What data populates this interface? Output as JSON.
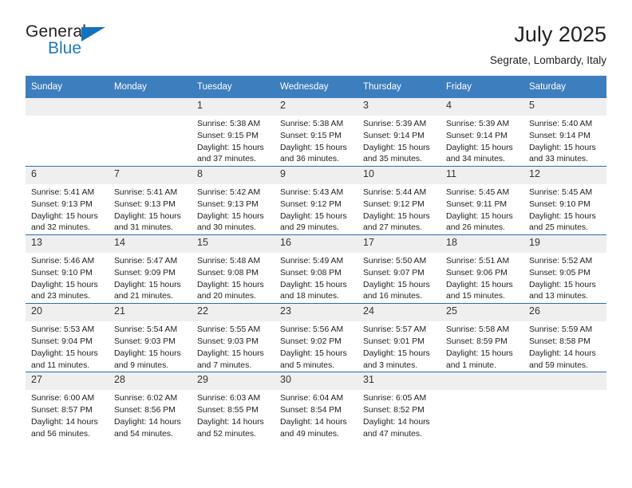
{
  "brand": {
    "name_top": "General",
    "name_bottom": "Blue",
    "triangle_color": "#1273bd",
    "blue_color": "#1c7ac0"
  },
  "header": {
    "title": "July 2025",
    "subtitle": "Segrate, Lombardy, Italy"
  },
  "theme": {
    "header_bg": "#3d7ebe",
    "row_divider": "#2b6cad",
    "daynum_bg": "#efefef"
  },
  "calendar": {
    "weekday_headers": [
      "Sunday",
      "Monday",
      "Tuesday",
      "Wednesday",
      "Thursday",
      "Friday",
      "Saturday"
    ],
    "weeks": [
      [
        {
          "day": "",
          "lines": []
        },
        {
          "day": "",
          "lines": []
        },
        {
          "day": "1",
          "lines": [
            "Sunrise: 5:38 AM",
            "Sunset: 9:15 PM",
            "Daylight: 15 hours",
            "and 37 minutes."
          ]
        },
        {
          "day": "2",
          "lines": [
            "Sunrise: 5:38 AM",
            "Sunset: 9:15 PM",
            "Daylight: 15 hours",
            "and 36 minutes."
          ]
        },
        {
          "day": "3",
          "lines": [
            "Sunrise: 5:39 AM",
            "Sunset: 9:14 PM",
            "Daylight: 15 hours",
            "and 35 minutes."
          ]
        },
        {
          "day": "4",
          "lines": [
            "Sunrise: 5:39 AM",
            "Sunset: 9:14 PM",
            "Daylight: 15 hours",
            "and 34 minutes."
          ]
        },
        {
          "day": "5",
          "lines": [
            "Sunrise: 5:40 AM",
            "Sunset: 9:14 PM",
            "Daylight: 15 hours",
            "and 33 minutes."
          ]
        }
      ],
      [
        {
          "day": "6",
          "lines": [
            "Sunrise: 5:41 AM",
            "Sunset: 9:13 PM",
            "Daylight: 15 hours",
            "and 32 minutes."
          ]
        },
        {
          "day": "7",
          "lines": [
            "Sunrise: 5:41 AM",
            "Sunset: 9:13 PM",
            "Daylight: 15 hours",
            "and 31 minutes."
          ]
        },
        {
          "day": "8",
          "lines": [
            "Sunrise: 5:42 AM",
            "Sunset: 9:13 PM",
            "Daylight: 15 hours",
            "and 30 minutes."
          ]
        },
        {
          "day": "9",
          "lines": [
            "Sunrise: 5:43 AM",
            "Sunset: 9:12 PM",
            "Daylight: 15 hours",
            "and 29 minutes."
          ]
        },
        {
          "day": "10",
          "lines": [
            "Sunrise: 5:44 AM",
            "Sunset: 9:12 PM",
            "Daylight: 15 hours",
            "and 27 minutes."
          ]
        },
        {
          "day": "11",
          "lines": [
            "Sunrise: 5:45 AM",
            "Sunset: 9:11 PM",
            "Daylight: 15 hours",
            "and 26 minutes."
          ]
        },
        {
          "day": "12",
          "lines": [
            "Sunrise: 5:45 AM",
            "Sunset: 9:10 PM",
            "Daylight: 15 hours",
            "and 25 minutes."
          ]
        }
      ],
      [
        {
          "day": "13",
          "lines": [
            "Sunrise: 5:46 AM",
            "Sunset: 9:10 PM",
            "Daylight: 15 hours",
            "and 23 minutes."
          ]
        },
        {
          "day": "14",
          "lines": [
            "Sunrise: 5:47 AM",
            "Sunset: 9:09 PM",
            "Daylight: 15 hours",
            "and 21 minutes."
          ]
        },
        {
          "day": "15",
          "lines": [
            "Sunrise: 5:48 AM",
            "Sunset: 9:08 PM",
            "Daylight: 15 hours",
            "and 20 minutes."
          ]
        },
        {
          "day": "16",
          "lines": [
            "Sunrise: 5:49 AM",
            "Sunset: 9:08 PM",
            "Daylight: 15 hours",
            "and 18 minutes."
          ]
        },
        {
          "day": "17",
          "lines": [
            "Sunrise: 5:50 AM",
            "Sunset: 9:07 PM",
            "Daylight: 15 hours",
            "and 16 minutes."
          ]
        },
        {
          "day": "18",
          "lines": [
            "Sunrise: 5:51 AM",
            "Sunset: 9:06 PM",
            "Daylight: 15 hours",
            "and 15 minutes."
          ]
        },
        {
          "day": "19",
          "lines": [
            "Sunrise: 5:52 AM",
            "Sunset: 9:05 PM",
            "Daylight: 15 hours",
            "and 13 minutes."
          ]
        }
      ],
      [
        {
          "day": "20",
          "lines": [
            "Sunrise: 5:53 AM",
            "Sunset: 9:04 PM",
            "Daylight: 15 hours",
            "and 11 minutes."
          ]
        },
        {
          "day": "21",
          "lines": [
            "Sunrise: 5:54 AM",
            "Sunset: 9:03 PM",
            "Daylight: 15 hours",
            "and 9 minutes."
          ]
        },
        {
          "day": "22",
          "lines": [
            "Sunrise: 5:55 AM",
            "Sunset: 9:03 PM",
            "Daylight: 15 hours",
            "and 7 minutes."
          ]
        },
        {
          "day": "23",
          "lines": [
            "Sunrise: 5:56 AM",
            "Sunset: 9:02 PM",
            "Daylight: 15 hours",
            "and 5 minutes."
          ]
        },
        {
          "day": "24",
          "lines": [
            "Sunrise: 5:57 AM",
            "Sunset: 9:01 PM",
            "Daylight: 15 hours",
            "and 3 minutes."
          ]
        },
        {
          "day": "25",
          "lines": [
            "Sunrise: 5:58 AM",
            "Sunset: 8:59 PM",
            "Daylight: 15 hours",
            "and 1 minute."
          ]
        },
        {
          "day": "26",
          "lines": [
            "Sunrise: 5:59 AM",
            "Sunset: 8:58 PM",
            "Daylight: 14 hours",
            "and 59 minutes."
          ]
        }
      ],
      [
        {
          "day": "27",
          "lines": [
            "Sunrise: 6:00 AM",
            "Sunset: 8:57 PM",
            "Daylight: 14 hours",
            "and 56 minutes."
          ]
        },
        {
          "day": "28",
          "lines": [
            "Sunrise: 6:02 AM",
            "Sunset: 8:56 PM",
            "Daylight: 14 hours",
            "and 54 minutes."
          ]
        },
        {
          "day": "29",
          "lines": [
            "Sunrise: 6:03 AM",
            "Sunset: 8:55 PM",
            "Daylight: 14 hours",
            "and 52 minutes."
          ]
        },
        {
          "day": "30",
          "lines": [
            "Sunrise: 6:04 AM",
            "Sunset: 8:54 PM",
            "Daylight: 14 hours",
            "and 49 minutes."
          ]
        },
        {
          "day": "31",
          "lines": [
            "Sunrise: 6:05 AM",
            "Sunset: 8:52 PM",
            "Daylight: 14 hours",
            "and 47 minutes."
          ]
        },
        {
          "day": "",
          "lines": []
        },
        {
          "day": "",
          "lines": []
        }
      ]
    ]
  }
}
